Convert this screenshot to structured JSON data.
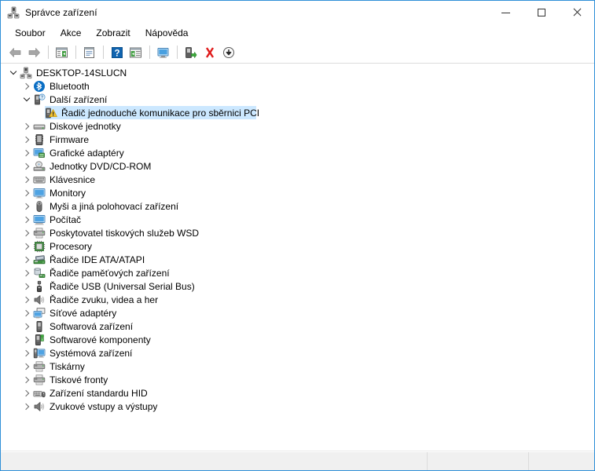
{
  "window": {
    "title": "Správce zařízení",
    "title_icon": "device-manager-icon",
    "minimize_label": "Minimalizovat",
    "maximize_label": "Maximalizovat",
    "close_label": "Zavřít"
  },
  "menubar": {
    "items": [
      {
        "label": "Soubor",
        "name": "menu-soubor"
      },
      {
        "label": "Akce",
        "name": "menu-akce"
      },
      {
        "label": "Zobrazit",
        "name": "menu-zobrazit"
      },
      {
        "label": "Nápověda",
        "name": "menu-napoveda"
      }
    ]
  },
  "toolbar": {
    "buttons": [
      {
        "icon": "back-arrow-icon",
        "label": "Zpět"
      },
      {
        "icon": "forward-arrow-icon",
        "label": "Vpřed"
      },
      {
        "sep": true
      },
      {
        "icon": "show-hide-console-tree-icon",
        "label": "Zobrazit nebo skrýt strom konzoly"
      },
      {
        "sep": true
      },
      {
        "icon": "properties-icon",
        "label": "Vlastnosti"
      },
      {
        "sep": true
      },
      {
        "icon": "help-icon",
        "label": "Nápověda"
      },
      {
        "icon": "scan-hardware-changes-icon",
        "label": "Vyhledat změny hardwaru"
      },
      {
        "sep": true
      },
      {
        "icon": "update-driver-icon",
        "label": "Aktualizovat ovladač"
      },
      {
        "sep": true
      },
      {
        "icon": "enable-device-icon",
        "label": "Povolit zařízení"
      },
      {
        "icon": "uninstall-device-icon",
        "label": "Odinstalovat zařízení"
      },
      {
        "icon": "disable-device-icon",
        "label": "Zakázat zařízení"
      }
    ]
  },
  "tree": {
    "nodes": [
      {
        "label": "DESKTOP-14SLUCN",
        "depth": 0,
        "state": "expanded",
        "icon": "computer-root-icon",
        "selected": false
      },
      {
        "label": "Bluetooth",
        "depth": 1,
        "state": "collapsed",
        "icon": "bluetooth-icon",
        "selected": false
      },
      {
        "label": "Další zařízení",
        "depth": 1,
        "state": "expanded",
        "icon": "other-devices-icon",
        "selected": false
      },
      {
        "label": "Řadič jednoduché komunikace pro sběrnici PCI",
        "depth": 2,
        "state": "leaf",
        "icon": "unknown-device-warning-icon",
        "selected": true
      },
      {
        "label": "Diskové jednotky",
        "depth": 1,
        "state": "collapsed",
        "icon": "disk-drive-icon",
        "selected": false
      },
      {
        "label": "Firmware",
        "depth": 1,
        "state": "collapsed",
        "icon": "firmware-icon",
        "selected": false
      },
      {
        "label": "Grafické adaptéry",
        "depth": 1,
        "state": "collapsed",
        "icon": "display-adapter-icon",
        "selected": false
      },
      {
        "label": "Jednotky DVD/CD-ROM",
        "depth": 1,
        "state": "collapsed",
        "icon": "dvd-drive-icon",
        "selected": false
      },
      {
        "label": "Klávesnice",
        "depth": 1,
        "state": "collapsed",
        "icon": "keyboard-icon",
        "selected": false
      },
      {
        "label": "Monitory",
        "depth": 1,
        "state": "collapsed",
        "icon": "monitor-icon",
        "selected": false
      },
      {
        "label": "Myši a jiná polohovací zařízení",
        "depth": 1,
        "state": "collapsed",
        "icon": "mouse-icon",
        "selected": false
      },
      {
        "label": "Počítač",
        "depth": 1,
        "state": "collapsed",
        "icon": "computer-icon",
        "selected": false
      },
      {
        "label": "Poskytovatel tiskových služeb WSD",
        "depth": 1,
        "state": "collapsed",
        "icon": "print-provider-icon",
        "selected": false
      },
      {
        "label": "Procesory",
        "depth": 1,
        "state": "collapsed",
        "icon": "processor-icon",
        "selected": false
      },
      {
        "label": "Řadiče IDE ATA/ATAPI",
        "depth": 1,
        "state": "collapsed",
        "icon": "ide-controller-icon",
        "selected": false
      },
      {
        "label": "Řadiče paměťových zařízení",
        "depth": 1,
        "state": "collapsed",
        "icon": "storage-controller-icon",
        "selected": false
      },
      {
        "label": "Řadiče USB (Universal Serial Bus)",
        "depth": 1,
        "state": "collapsed",
        "icon": "usb-controller-icon",
        "selected": false
      },
      {
        "label": "Řadiče zvuku, videa a her",
        "depth": 1,
        "state": "collapsed",
        "icon": "sound-controller-icon",
        "selected": false
      },
      {
        "label": "Síťové adaptéry",
        "depth": 1,
        "state": "collapsed",
        "icon": "network-adapter-icon",
        "selected": false
      },
      {
        "label": "Softwarová zařízení",
        "depth": 1,
        "state": "collapsed",
        "icon": "software-device-icon",
        "selected": false
      },
      {
        "label": "Softwarové komponenty",
        "depth": 1,
        "state": "collapsed",
        "icon": "software-component-icon",
        "selected": false
      },
      {
        "label": "Systémová zařízení",
        "depth": 1,
        "state": "collapsed",
        "icon": "system-device-icon",
        "selected": false
      },
      {
        "label": "Tiskárny",
        "depth": 1,
        "state": "collapsed",
        "icon": "printer-icon",
        "selected": false
      },
      {
        "label": "Tiskové fronty",
        "depth": 1,
        "state": "collapsed",
        "icon": "print-queue-icon",
        "selected": false
      },
      {
        "label": "Zařízení standardu HID",
        "depth": 1,
        "state": "collapsed",
        "icon": "hid-device-icon",
        "selected": false
      },
      {
        "label": "Zvukové vstupy a výstupy",
        "depth": 1,
        "state": "collapsed",
        "icon": "audio-io-icon",
        "selected": false
      }
    ]
  },
  "statusbar": {
    "cells": [
      "",
      "",
      ""
    ]
  },
  "colors": {
    "window_border": "#2f8fd8",
    "selection": "#cce8ff",
    "statusbar_bg": "#f0f0f0",
    "text": "#000000"
  }
}
